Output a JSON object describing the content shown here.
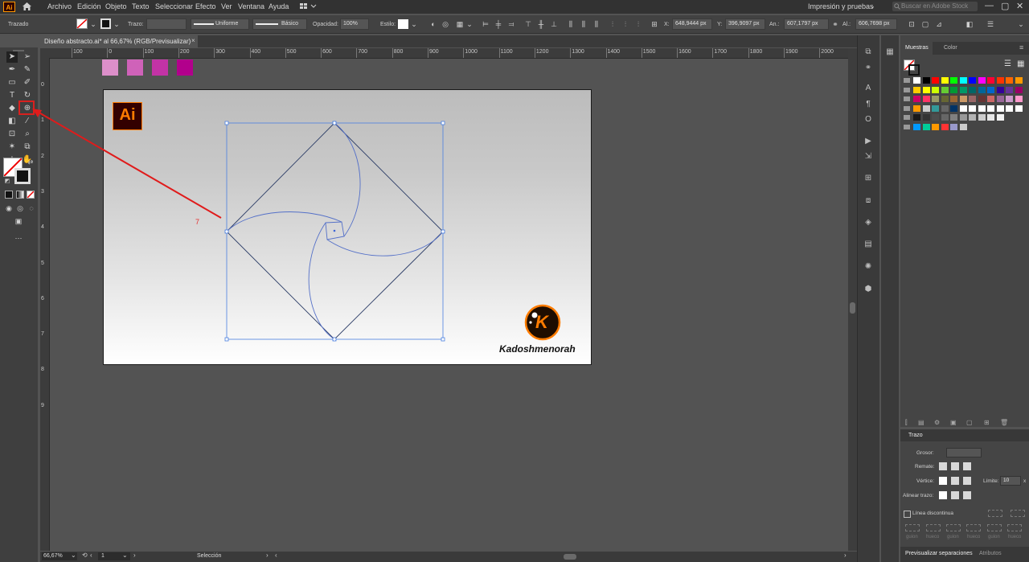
{
  "app": {
    "logo": "Ai",
    "menu": [
      "Archivo",
      "Edición",
      "Objeto",
      "Texto",
      "Seleccionar",
      "Efecto",
      "Ver",
      "Ventana",
      "Ayuda"
    ],
    "workspace": "Impresión y pruebas",
    "stock_search_placeholder": "Buscar en Adobe Stock",
    "window_controls": [
      "—",
      "▢",
      "✕"
    ]
  },
  "control_bar": {
    "selection_type": "Trazado",
    "stroke_label": "Trazo:",
    "stroke_profile": "Uniforme",
    "brush": "Básico",
    "opacity_label": "Opacidad:",
    "opacity_value": "100%",
    "style_label": "Estilo:",
    "x_label": "X:",
    "x_value": "648,9444 px",
    "y_label": "Y:",
    "y_value": "396,9097 px",
    "w_label": "An.:",
    "w_value": "607,1797 px",
    "h_label": "Al.:",
    "h_value": "606,7698 px"
  },
  "document": {
    "tab_title": "Diseño abstracto.ai* al 66,67% (RGB/Previsualizar)",
    "close": "×"
  },
  "ruler": {
    "h_ticks": [
      "100",
      "0",
      "100",
      "200",
      "300",
      "400",
      "500",
      "600",
      "700",
      "800",
      "900",
      "1000",
      "1100",
      "1200",
      "1300",
      "1400",
      "1500",
      "1600",
      "1700",
      "1800",
      "1900",
      "2000"
    ],
    "v_ticks": [
      "0",
      "1",
      "2",
      "3",
      "4",
      "5",
      "6",
      "7",
      "8",
      "9"
    ]
  },
  "artboard": {
    "swatches": [
      "#dd8fca",
      "#cf62b9",
      "#c333a6",
      "#b2008c"
    ],
    "ai_logo_text": "Ai",
    "brand_text": "Kadoshmenorah",
    "brand_logo_letter": "K",
    "annotation_number": "7"
  },
  "status_bar": {
    "zoom": "66,67%",
    "page": "1",
    "tool": "Selección"
  },
  "swatches_panel": {
    "tab_active": "Muestras",
    "tab_other": "Color",
    "rows": [
      [
        "#ffffff",
        "#000000",
        "#ff0000",
        "#ffff00",
        "#00ff00",
        "#00ffff",
        "#0000ff",
        "#ff00ff",
        "#ff0033",
        "#ff3300",
        "#ff6600",
        "#ff9900"
      ],
      [
        "#ffcc00",
        "#ffff00",
        "#ccff00",
        "#66cc33",
        "#009933",
        "#009966",
        "#006666",
        "#006699",
        "#0066cc",
        "#330099",
        "#663399",
        "#990066"
      ],
      [
        "#cc0066",
        "#ff3366",
        "#999966",
        "#666633",
        "#996633",
        "#cc9966",
        "#996666",
        "#663333",
        "#cc6666",
        "#996699",
        "#cc99cc",
        "#ff99cc"
      ],
      [
        "#ff9900",
        "#cccccc",
        "#339999",
        "#666666",
        "#003366",
        "#ffffff",
        "#ffffff",
        "#ffffff",
        "#ffffff",
        "#ffffff",
        "#ffffff",
        "#ffffff"
      ],
      [
        "#1a1a1a",
        "#333333",
        "#4d4d4d",
        "#666666",
        "#808080",
        "#999999",
        "#b3b3b3",
        "#cccccc",
        "#e6e6e6",
        "#f2f2f2"
      ],
      [
        "#0099ff",
        "#00cc99",
        "#ff9900",
        "#ff3333",
        "#9999cc",
        "#cccccc"
      ]
    ]
  },
  "stroke_panel": {
    "title": "Trazo",
    "weight_label": "Grosor:",
    "cap_label": "Remate:",
    "corner_label": "Vértice:",
    "limit_label": "Límite:",
    "limit_value": "10",
    "limit_unit": "x",
    "align_label": "Alinear trazo:",
    "dashed_label": "Línea discontinua",
    "dash_labels": [
      "guion",
      "hueco",
      "guion",
      "hueco",
      "guion",
      "hueco"
    ]
  },
  "bottom_tabs": {
    "active": "Previsualizar separaciones",
    "other": "Atributos"
  }
}
